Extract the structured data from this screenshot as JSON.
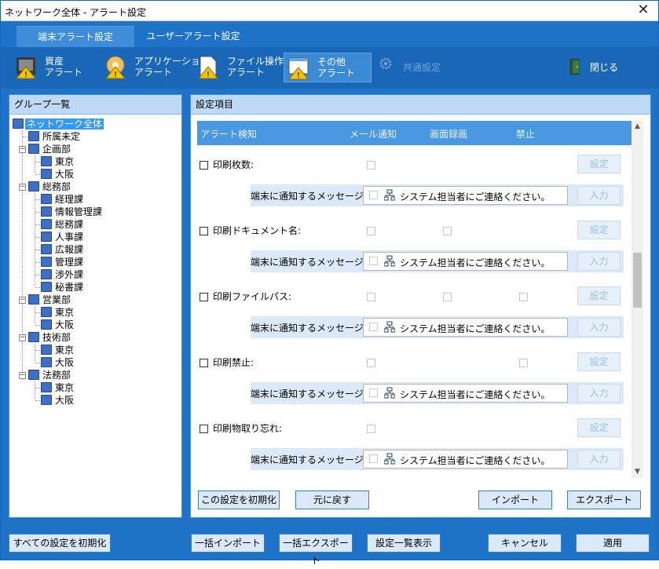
{
  "window": {
    "title": "ネットワーク全体 - アラート設定",
    "close": "✕"
  },
  "tabs": [
    {
      "label": "端末アラート設定"
    },
    {
      "label": "ユーザーアラート設定"
    }
  ],
  "toolbar": [
    {
      "label1": "資産",
      "label2": "アラート"
    },
    {
      "label1": "アプリケーション",
      "label2": "アラート"
    },
    {
      "label1": "ファイル操作",
      "label2": "アラート"
    },
    {
      "label1": "その他",
      "label2": "アラート"
    },
    {
      "label1": "共通設定",
      "label2": ""
    },
    {
      "label1": "閉じる",
      "label2": ""
    }
  ],
  "group_panel": {
    "header": "グループ一覧",
    "tree": [
      "ネットワーク全体",
      "所属未定",
      "企画部",
      "東京",
      "大阪",
      "総務部",
      "経理課",
      "情報管理課",
      "総務課",
      "人事課",
      "広報課",
      "管理課",
      "渉外課",
      "秘書課",
      "営業部",
      "東京",
      "大阪",
      "技術部",
      "東京",
      "大阪",
      "法務部",
      "東京",
      "大阪"
    ]
  },
  "settings_panel": {
    "header": "設定項目",
    "columns": [
      "アラート検知",
      "メール通知",
      "画面録画",
      "禁止"
    ],
    "message_label": "端末に通知するメッセージ:",
    "rows": [
      {
        "label": "印刷枚数:",
        "message": "システム担当者にご連絡ください。",
        "set_btn": "設定",
        "input_btn": "入力"
      },
      {
        "label": "印刷ドキュメント名:",
        "message": "システム担当者にご連絡ください。",
        "set_btn": "設定",
        "input_btn": "入力"
      },
      {
        "label": "印刷ファイルパス:",
        "message": "システム担当者にご連絡ください。",
        "set_btn": "設定",
        "input_btn": "入力"
      },
      {
        "label": "印刷禁止:",
        "message": "システム担当者にご連絡ください。",
        "set_btn": "設定",
        "input_btn": "入力"
      },
      {
        "label": "印刷物取り忘れ:",
        "message": "システム担当者にご連絡ください。",
        "set_btn": "設定",
        "input_btn": "入力"
      }
    ],
    "buttons": {
      "reset": "この設定を初期化",
      "revert": "元に戻す",
      "import": "インポート",
      "export": "エクスポート"
    }
  },
  "bottom": {
    "reset_all": "すべての設定を初期化",
    "bulk_import": "一括インポート",
    "bulk_export": "一括エクスポート",
    "list_view": "設定一覧表示",
    "cancel": "キャンセル",
    "apply": "適用"
  }
}
